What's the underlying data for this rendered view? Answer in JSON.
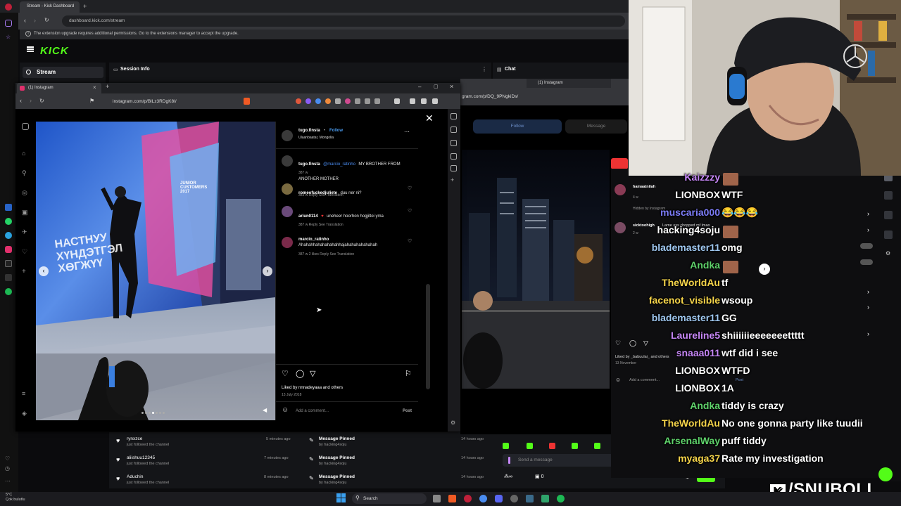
{
  "browser": {
    "tab_title": "Stream - Kick Dashboard",
    "url": "dashboard.kick.com/stream",
    "extension_banner": "The extension upgrade requires additional permissions. Go to the extensions manager to accept the upgrade."
  },
  "kick": {
    "logo": "KICK",
    "sidebar_stream": "Stream",
    "session_title": "Session Info",
    "chat_title": "Chat",
    "feed": [
      {
        "name": "rynxzce",
        "sub": "just followed the channel",
        "time": "5 minutes ago"
      },
      {
        "name": "aliishuu12345",
        "sub": "just followed the channel",
        "time": "7 minutes ago"
      },
      {
        "name": "Aduchin",
        "sub": "just followed the channel",
        "time": "8 minutes ago"
      }
    ],
    "pinned": [
      {
        "title": "Message Pinned",
        "by": "by hacking4soju",
        "time": "14 hours ago"
      },
      {
        "title": "Message Pinned",
        "by": "by hacking4soju",
        "time": "14 hours ago"
      },
      {
        "title": "Message Pinned",
        "by": "by hacking4soju",
        "time": "14 hours ago"
      }
    ],
    "send_placeholder": "Send a message",
    "chat_button": "Chat",
    "viewer_count": "0"
  },
  "instagram": {
    "tab_title": "(1) Instagram",
    "url": "instagram.com/p/BlLz3RDgK8I/",
    "post_user": "tugo.finsta",
    "follow_label": "Follow",
    "location": "Ulaanbaatar, Mongolia",
    "comments": [
      {
        "user": "tugo.finsta",
        "mention": "@marcio_ratinho",
        "text": "MY BROTHER FROM ANOTHER MOTHER",
        "meta": "387 w"
      },
      {
        "user": "romeofuckedjuliete",
        "text": "duu ner ni?",
        "meta": "383 w   Reply   See Translation"
      },
      {
        "user": "ariun0114",
        "text": "uneheer hoorhon hogjiltoi yma",
        "meta": "387 w   Reply   See Translation"
      },
      {
        "user": "marcio_ratinho",
        "text": "Ahahahhahahahahahhajahahahahahahah",
        "meta": "387 w   2 likes   Reply   See Translation"
      }
    ],
    "liked_by": "Liked by nnnadeyaaa and others",
    "date": "13 July 2018",
    "comment_placeholder": "Add a comment...",
    "post_label": "Post",
    "photo_sign_1": "JUNIOR",
    "photo_sign_2": "CUSTOMERS",
    "photo_sign_3": "2017",
    "photo_wall_text": "НАСТНУУ ХҮНДЭТГЭЛ ХӨГЖҮҮ"
  },
  "instagram2": {
    "tab_title": "(1) Instagram",
    "url": "gram.com/p/DQ_9PNgkiDs/",
    "follow_label": "Follow",
    "message_label": "Message",
    "commenter1": "hamaatnilah",
    "commenter1_meta": "4 w",
    "hidden_label": "Hidden by Instagram",
    "commenter2": "sicktoohigh",
    "commenter2_text": "Lame ass chopped mf lmao",
    "commenter2_meta": "2 w",
    "liked_by": "Liked by _babuulai_ and others",
    "date": "13 November",
    "comment_placeholder": "Add a comment...",
    "post_label": "Post"
  },
  "overlay_chat": [
    {
      "name": "Kaizzzy",
      "color": "#c586f5",
      "msg": "",
      "emote": true
    },
    {
      "name": "LIONBOX",
      "color": "#ffffff",
      "msg": "WTF",
      "emote": false
    },
    {
      "name": "muscaria000",
      "color": "#7c7cf7",
      "msg": "😂😂😂",
      "emote": false
    },
    {
      "name": "hacking4soju",
      "color": "#ffffff",
      "msg": "",
      "emote": true
    },
    {
      "name": "blademaster11",
      "color": "#9fc7f0",
      "msg": "omg",
      "emote": false
    },
    {
      "name": "Andka",
      "color": "#5ed16a",
      "msg": "",
      "emote": true
    },
    {
      "name": "TheWorldAu",
      "color": "#f5d44a",
      "msg": "tf",
      "emote": false
    },
    {
      "name": "facenot_visible",
      "color": "#f5d44a",
      "msg": "wsoup",
      "emote": false
    },
    {
      "name": "blademaster11",
      "color": "#9fc7f0",
      "msg": "GG",
      "emote": false
    },
    {
      "name": "Laureline5",
      "color": "#c586f5",
      "msg": "shiiiiiieeeeeeettttt",
      "emote": false
    },
    {
      "name": "snaaa011",
      "color": "#c586f5",
      "msg": "wtf did i see",
      "emote": false
    },
    {
      "name": "LIONBOX",
      "color": "#ffffff",
      "msg": "WTFD",
      "emote": false
    },
    {
      "name": "LIONBOX",
      "color": "#ffffff",
      "msg": "1A",
      "emote": false
    },
    {
      "name": "Andka",
      "color": "#5ed16a",
      "msg": "tiddy is crazy",
      "emote": false
    },
    {
      "name": "TheWorldAu",
      "color": "#f5d44a",
      "msg": "No one gonna party like tuudii",
      "emote": false
    },
    {
      "name": "ArsenalWay",
      "color": "#5ed16a",
      "msg": "puff tiddy",
      "emote": false
    },
    {
      "name": "myaga37",
      "color": "#f5d44a",
      "msg": "Rate my investigation",
      "emote": false
    }
  ],
  "brand": {
    "k": "K",
    "text": "/SNUBOLI"
  },
  "taskbar": {
    "search": "Search",
    "weather_temp": "5°C",
    "weather_desc": "Çok bulutlu"
  }
}
